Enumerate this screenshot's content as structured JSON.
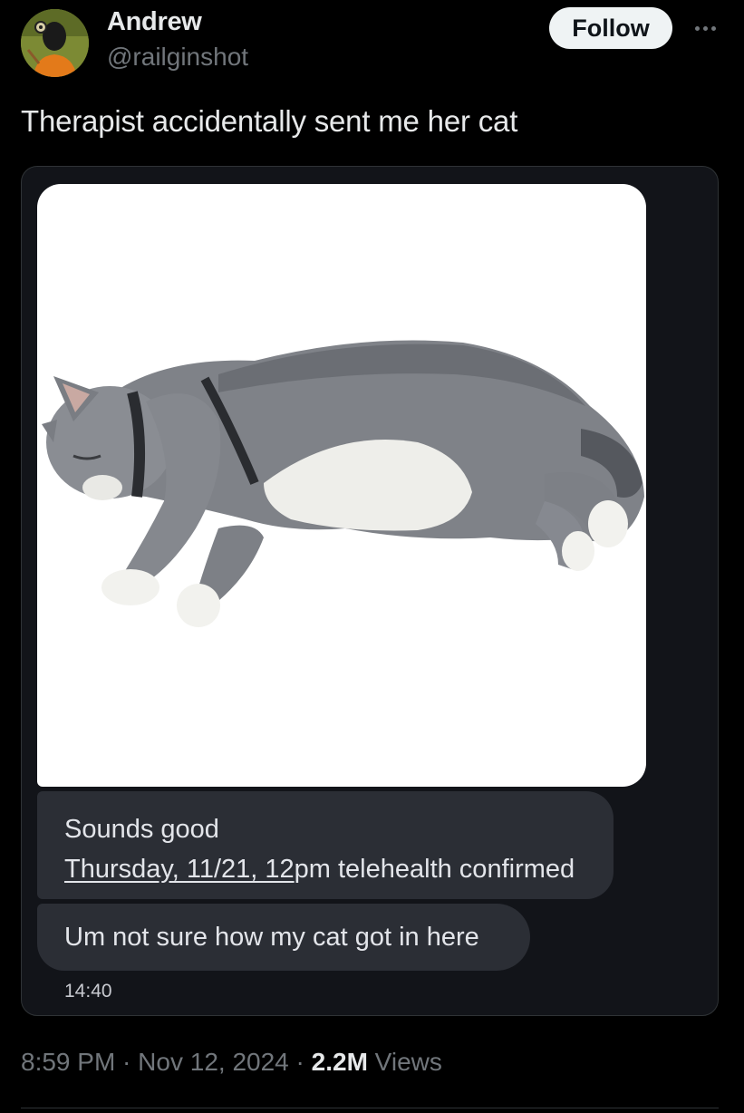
{
  "author": {
    "display_name": "Andrew",
    "handle": "@railginshot",
    "avatar_icon": "avatar-photo"
  },
  "actions": {
    "follow_label": "Follow",
    "more_icon": "more-horizontal-icon"
  },
  "tweet": {
    "text": "Therapist accidentally sent me her cat"
  },
  "media": {
    "image_subject": "cat-photo",
    "messages": [
      {
        "line1": "Sounds good",
        "line2_underlined": "Thursday, 11/21, 12",
        "line2_rest": "pm telehealth confirmed"
      },
      {
        "line1": "Um not sure how my cat got in here"
      }
    ],
    "message_time": "14:40"
  },
  "meta": {
    "time": "8:59 PM",
    "separator": " · ",
    "date": "Nov 12, 2024",
    "views_count": "2.2M",
    "views_label": "Views"
  },
  "colors": {
    "background": "#000000",
    "text_primary": "#e7e9ea",
    "text_secondary": "#71767b",
    "follow_button_bg": "#eff3f4",
    "bubble_bg": "#2b2e35",
    "card_bg": "#121419"
  }
}
